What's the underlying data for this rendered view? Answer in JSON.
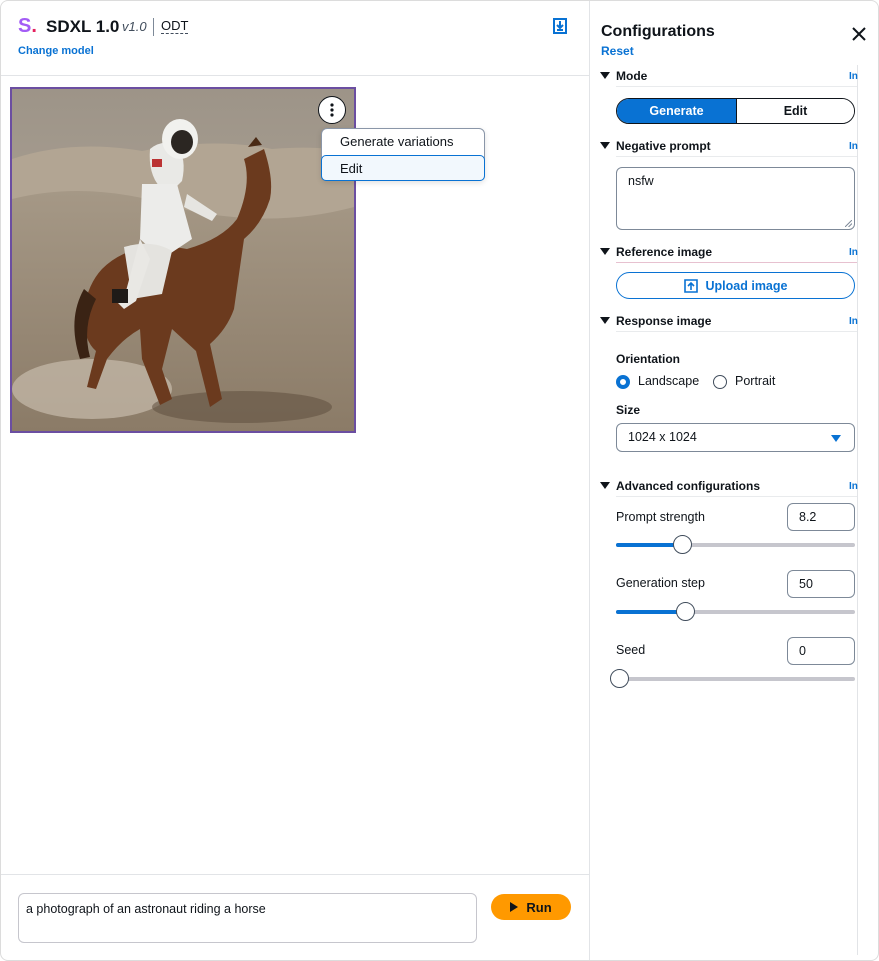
{
  "header": {
    "logo": "S",
    "logo_dot": ".",
    "model_name": "SDXL 1.0",
    "model_version": "v1.0",
    "tag": "ODT",
    "change_model": "Change model"
  },
  "image_menu": {
    "items": [
      "Generate variations",
      "Edit"
    ]
  },
  "prompt": {
    "value": "a photograph of an astronaut riding a horse"
  },
  "run_button": {
    "label": "Run"
  },
  "config": {
    "title": "Configurations",
    "reset": "Reset",
    "info_link": "In",
    "mode": {
      "label": "Mode",
      "options": [
        "Generate",
        "Edit"
      ],
      "selected": "Generate"
    },
    "negative_prompt": {
      "label": "Negative prompt",
      "value": "nsfw"
    },
    "reference_image": {
      "label": "Reference image",
      "upload": "Upload image"
    },
    "response_image": {
      "label": "Response image",
      "orientation_label": "Orientation",
      "orientation_options": [
        "Landscape",
        "Portrait"
      ],
      "orientation_selected": "Landscape",
      "size_label": "Size",
      "size_value": "1024 x 1024"
    },
    "advanced": {
      "label": "Advanced configurations",
      "prompt_strength": {
        "label": "Prompt strength",
        "value": "8.2",
        "fraction": 0.28
      },
      "generation_step": {
        "label": "Generation step",
        "value": "50",
        "fraction": 0.29
      },
      "seed": {
        "label": "Seed",
        "value": "0",
        "fraction": 0.0
      }
    }
  },
  "colors": {
    "accent": "#0972d3",
    "run": "#ff9900",
    "logo": "#a35cf5",
    "image_border": "#6b4ea1"
  }
}
